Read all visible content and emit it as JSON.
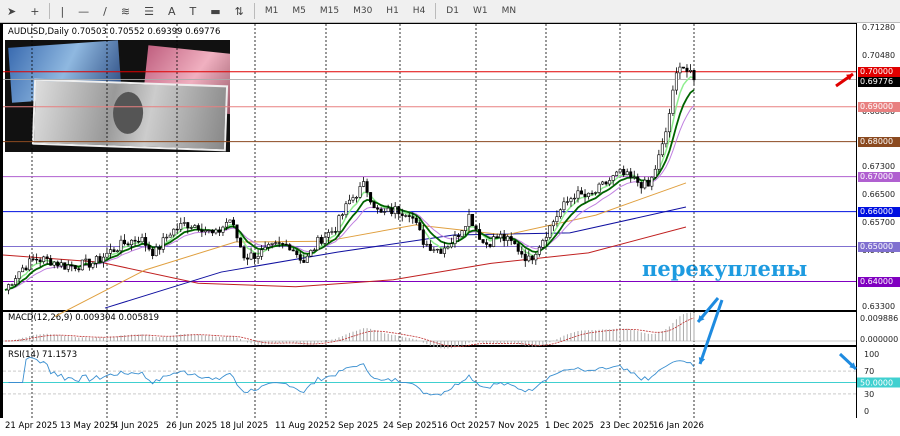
{
  "toolbar": {
    "tools": [
      "cursor-icon",
      "crosshair-icon",
      "vertical-line-icon",
      "horizontal-line-icon",
      "trendline-icon",
      "fibonacci-icon",
      "fibo-levels-icon",
      "text-icon",
      "text-label-icon",
      "rectangle-icon",
      "arrows-icon"
    ],
    "timeframes": [
      "M1",
      "M5",
      "M15",
      "M30",
      "H1",
      "H4",
      "D1",
      "W1",
      "MN"
    ]
  },
  "chart": {
    "symbol_line": "AUDUSD,Daily  0.70503 0.70552 0.69399 0.69776",
    "price_ticks": [
      "0.71280",
      "0.70480",
      "0.68880",
      "0.67300",
      "0.66500",
      "0.65700",
      "0.64900",
      "0.63300"
    ],
    "levels": [
      {
        "value": "0.70000",
        "color": "#e00000"
      },
      {
        "value": "0.69000",
        "color": "#e88080"
      },
      {
        "value": "0.68000",
        "color": "#8b4a20"
      },
      {
        "value": "0.67000",
        "color": "#b060d0"
      },
      {
        "value": "0.66000",
        "color": "#0010e0"
      },
      {
        "value": "0.65000",
        "color": "#8070d0"
      },
      {
        "value": "0.64000",
        "color": "#8000c0"
      }
    ],
    "current_price": "0.69776",
    "annotation": "перекуплены"
  },
  "macd": {
    "label": "MACD(12,26,9) 0.009304 0.005819",
    "ticks": [
      "0.009886",
      "0.000000"
    ]
  },
  "rsi": {
    "label": "RSI(14) 71.1573",
    "ticks": [
      "100",
      "70",
      "30",
      "0"
    ],
    "level_50": "50.0000"
  },
  "dates": [
    "21 Apr 2025",
    "13 May 2025",
    "4 Jun 2025",
    "26 Jun 2025",
    "18 Jul 2025",
    "11 Aug 2025",
    "2 Sep 2025",
    "24 Sep 2025",
    "16 Oct 2025",
    "7 Nov 2025",
    "1 Dec 2025",
    "23 Dec 2025",
    "16 Jan 2026"
  ],
  "chart_data": {
    "type": "candlestick",
    "ylim": [
      0.633,
      0.7128
    ],
    "closes": [
      0.6376,
      0.6433,
      0.6465,
      0.646,
      0.6445,
      0.6447,
      0.6455,
      0.6485,
      0.651,
      0.6525,
      0.648,
      0.654,
      0.6565,
      0.656,
      0.653,
      0.658,
      0.647,
      0.648,
      0.65,
      0.6505,
      0.6455,
      0.652,
      0.655,
      0.663,
      0.6677,
      0.659,
      0.6605,
      0.66,
      0.651,
      0.649,
      0.652,
      0.659,
      0.6505,
      0.653,
      0.6505,
      0.646,
      0.653,
      0.66,
      0.665,
      0.664,
      0.6677,
      0.671,
      0.669,
      0.667,
      0.68,
      0.703,
      0.6977
    ],
    "ma_red": [
      0.6476,
      0.6455,
      0.6395,
      0.6385,
      0.6405,
      0.6452,
      0.6482,
      0.6556
    ],
    "ma_blue": [
      0.6324,
      0.6427,
      0.6484,
      0.6533,
      0.6539,
      0.6613
    ],
    "ma_orange": [
      0.63,
      0.6433,
      0.6513,
      0.6515,
      0.6562,
      0.6533,
      0.659,
      0.6682
    ]
  },
  "colors": {
    "bull": "#ffffff",
    "bear": "#000000",
    "ma_fast": "#90ee90",
    "ma_mid": "#006400",
    "ma_slow": "#c080e0",
    "rsi": "#3a8fd0",
    "rsi50": "#40d0d0",
    "arrow_red": "#e00000",
    "arrow_blue": "#1e8be0"
  }
}
